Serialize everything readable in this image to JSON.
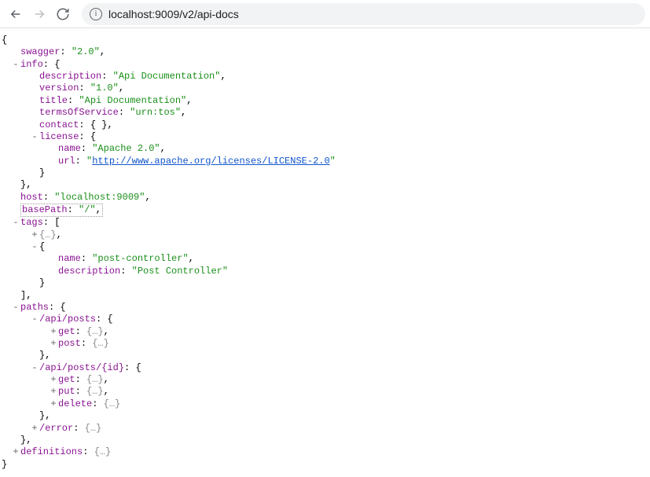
{
  "browser": {
    "url": "localhost:9009/v2/api-docs"
  },
  "json": {
    "swagger_key": "swagger",
    "swagger_val": "\"2.0\"",
    "info_key": "info",
    "description_key": "description",
    "description_val": "\"Api Documentation\"",
    "version_key": "version",
    "version_val": "\"1.0\"",
    "title_key": "title",
    "title_val": "\"Api Documentation\"",
    "tos_key": "termsOfService",
    "tos_val": "\"urn:tos\"",
    "contact_key": "contact",
    "license_key": "license",
    "name_key": "name",
    "license_name_val": "\"Apache 2.0\"",
    "url_key": "url",
    "license_url_val": "http://www.apache.org/licenses/LICENSE-2.0",
    "host_key": "host",
    "host_val": "\"localhost:9009\"",
    "basepath_key": "basePath",
    "basepath_val": "\"/\"",
    "tags_key": "tags",
    "tag_name_val": "\"post-controller\"",
    "tag_desc_val": "\"Post Controller\"",
    "paths_key": "paths",
    "path1_key": "/api/posts",
    "path2_key": "/api/posts/{id}",
    "get_key": "get",
    "post_key": "post",
    "put_key": "put",
    "delete_key": "delete",
    "error_key": "/error",
    "definitions_key": "definitions",
    "empty_obj": "{ }",
    "collapsed_obj": "{…}",
    "open_brace": "{",
    "close_brace": "}",
    "open_bracket": "[",
    "close_bracket": "]",
    "comma": ",",
    "colon": ": ",
    "quote": "\""
  }
}
